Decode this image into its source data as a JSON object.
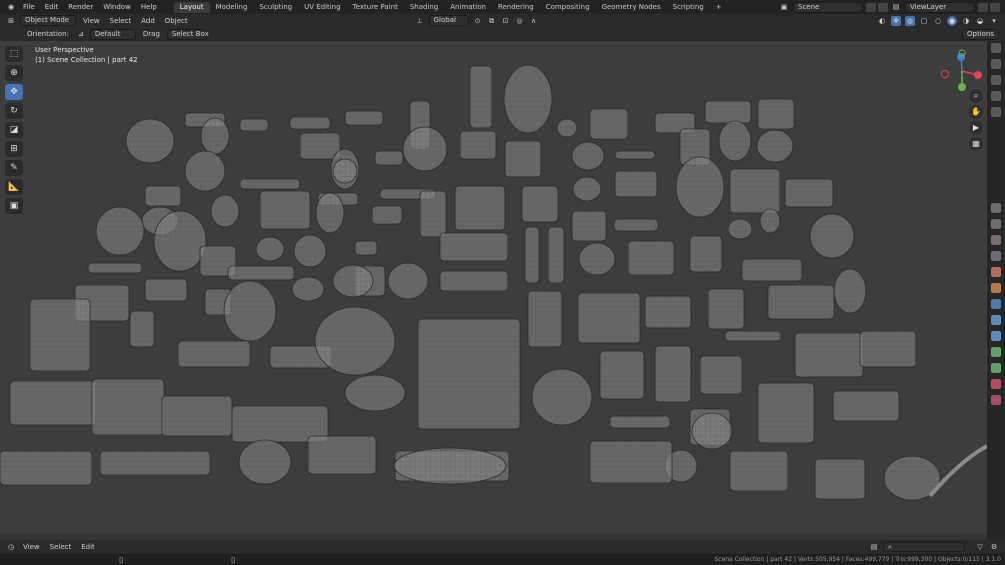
{
  "topbar": {
    "menus": [
      "File",
      "Edit",
      "Render",
      "Window",
      "Help"
    ],
    "workspaces": [
      "Layout",
      "Modeling",
      "Sculpting",
      "UV Editing",
      "Texture Paint",
      "Shading",
      "Animation",
      "Rendering",
      "Compositing",
      "Geometry Nodes",
      "Scripting"
    ],
    "active_workspace": "Layout",
    "add_tab": "+",
    "scene": "Scene",
    "view_layer": "ViewLayer"
  },
  "header2": {
    "mode": "Object Mode",
    "menus": [
      "View",
      "Select",
      "Add",
      "Object"
    ],
    "transform": "Global"
  },
  "tool_options": {
    "orientation_label": "Orientation:",
    "orientation_value": "Default",
    "drag_label": "Drag",
    "drag_value": "Select Box",
    "options": "Options"
  },
  "viewport": {
    "perspective": "User Perspective",
    "collection": "(1) Scene Collection | part 42",
    "background": "#3d3d3d",
    "gizmo_axes": {
      "x": "#e8424f",
      "y": "#6ab343",
      "z": "#3b85d8"
    }
  },
  "timeline": {
    "menus": [
      "View",
      "Select",
      "Edit"
    ]
  },
  "statusbar": {
    "text": "Scene Collection | part 42 | Verts:505,954 | Faces:499,779 | Tris:999,300 | Objects:0/115 | 3.1.0"
  }
}
